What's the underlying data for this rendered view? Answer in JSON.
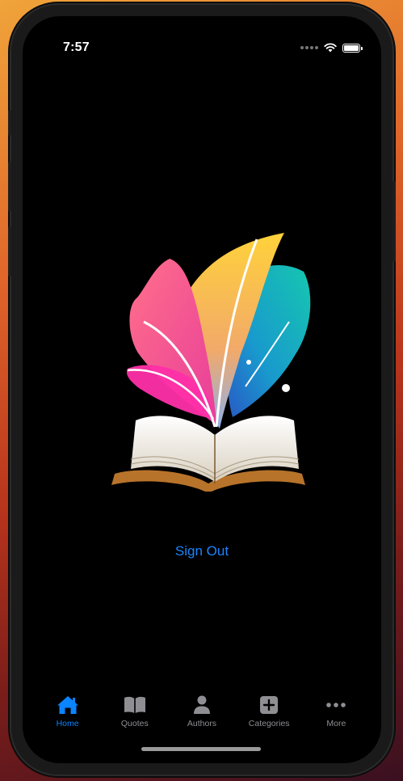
{
  "status": {
    "time": "7:57"
  },
  "main": {
    "action_label": "Sign Out"
  },
  "tabs": [
    {
      "label": "Home",
      "icon": "house-icon",
      "active": true
    },
    {
      "label": "Quotes",
      "icon": "book-icon",
      "active": false
    },
    {
      "label": "Authors",
      "icon": "person-icon",
      "active": false
    },
    {
      "label": "Categories",
      "icon": "plus-square-icon",
      "active": false
    },
    {
      "label": "More",
      "icon": "ellipsis-icon",
      "active": false
    }
  ],
  "colors": {
    "accent": "#0a84ff",
    "inactive": "#8e8e93",
    "background": "#000000"
  }
}
